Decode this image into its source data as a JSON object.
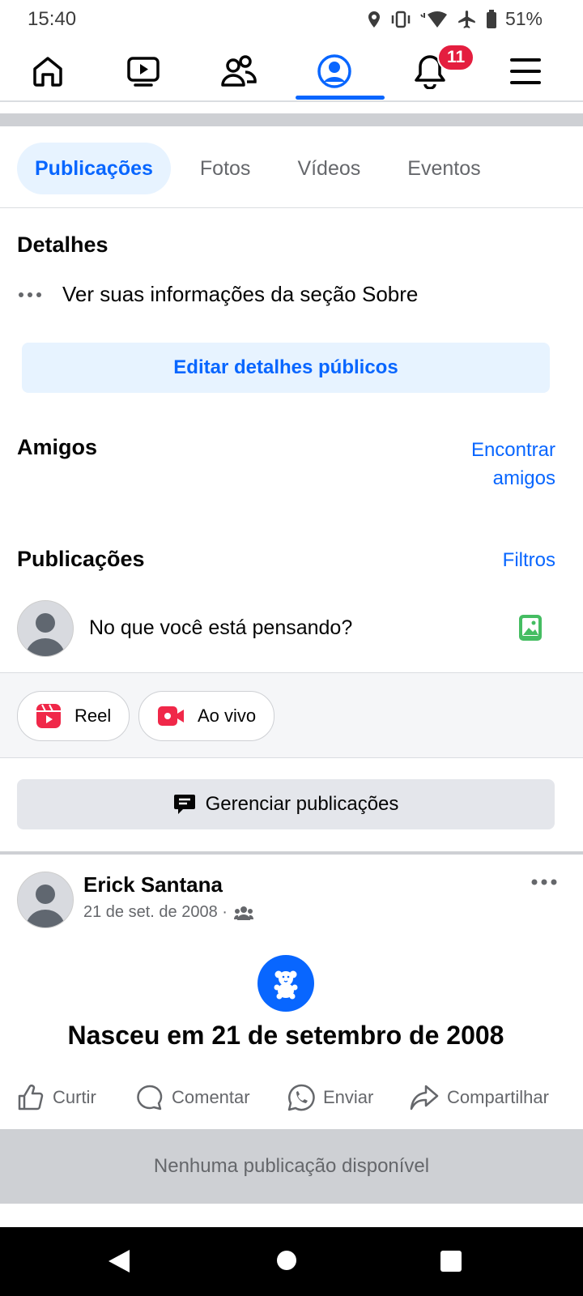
{
  "status_bar": {
    "time": "15:40",
    "battery": "51%"
  },
  "nav": {
    "notifications_count": "11"
  },
  "tabs": [
    "Publicações",
    "Fotos",
    "Vídeos",
    "Eventos"
  ],
  "details": {
    "title": "Detalhes",
    "about_text": "Ver suas informações da seção Sobre",
    "edit_button": "Editar detalhes públicos"
  },
  "friends": {
    "title": "Amigos",
    "find_line1": "Encontrar",
    "find_line2": "amigos"
  },
  "posts": {
    "title": "Publicações",
    "filters": "Filtros",
    "composer_placeholder": "No que você está pensando?",
    "reel": "Reel",
    "live": "Ao vivo",
    "manage": "Gerenciar publicações"
  },
  "post": {
    "author": "Erick Santana",
    "date": "21 de set. de 2008 ·",
    "life_event": "Nasceu em 21 de setembro de 2008",
    "actions": {
      "like": "Curtir",
      "comment": "Comentar",
      "send": "Enviar",
      "share": "Compartilhar"
    }
  },
  "footer_text": "Nenhuma publicação disponível",
  "colors": {
    "accent": "#0866ff",
    "badge": "#e41e3f",
    "reel": "#f02849",
    "photo": "#45bd62"
  }
}
